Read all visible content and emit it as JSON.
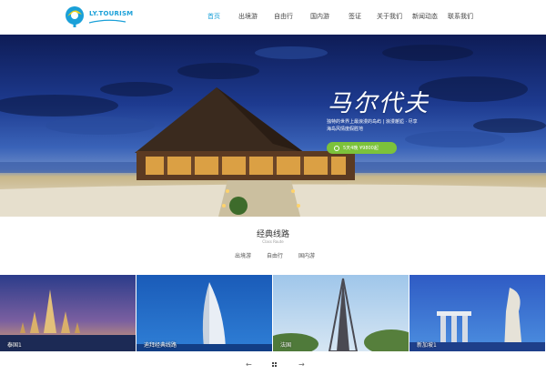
{
  "header": {
    "logo_text": "LY.TOURISM",
    "nav": [
      {
        "label": "首页",
        "active": true
      },
      {
        "label": "出境游",
        "active": false
      },
      {
        "label": "自由行",
        "active": false
      },
      {
        "label": "国内游",
        "active": false
      },
      {
        "label": "签证",
        "active": false
      },
      {
        "label": "关于我们",
        "active": false
      },
      {
        "label": "新闻动态",
        "active": false
      },
      {
        "label": "联系我们",
        "active": false
      }
    ]
  },
  "banner": {
    "title": "马尔代夫",
    "desc": "独特的世界上最浪漫的岛屿 | 浪漫邂逅 · 尽享海岛风情度假胜地",
    "button_label": "5天4晚 ¥9800起"
  },
  "section": {
    "title": "经典线路",
    "subtitle": "Class Route",
    "tabs": [
      "出境游",
      "自由行",
      "国内游"
    ]
  },
  "cards": [
    {
      "label": "泰国1",
      "icon": "temple"
    },
    {
      "label": "迪拜经典线路",
      "icon": "burj-al-arab"
    },
    {
      "label": "法国",
      "icon": "eiffel-tower"
    },
    {
      "label": "新加坡1",
      "icon": "merlion"
    }
  ],
  "pager": {
    "prev": "←",
    "next": "→"
  },
  "colors": {
    "accent": "#1aa0d8",
    "button_green": "#7cc23b"
  }
}
